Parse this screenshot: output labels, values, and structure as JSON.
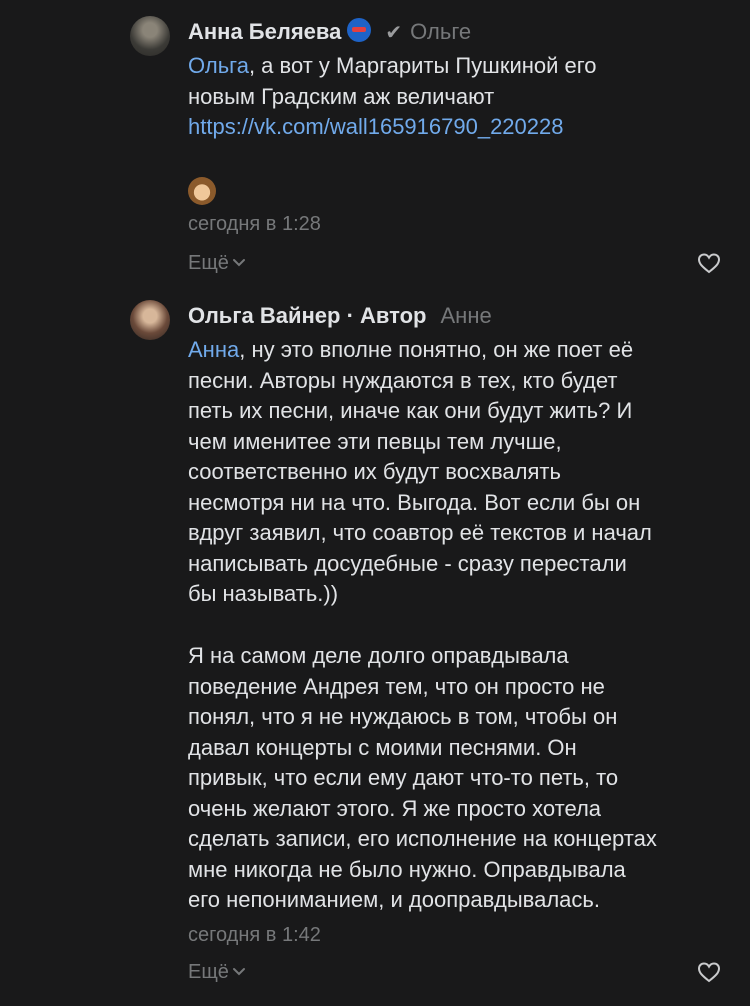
{
  "comments": [
    {
      "author": "Анна Беляева",
      "reply_to": "Ольге",
      "lines": {
        "l1_mention": "Ольга",
        "l1_rest": ", а вот у Маргариты Пушкиной его",
        "l2": "новым Градским аж величают",
        "l3_link": "https://vk.com/wall165916790_220228"
      },
      "emoji": "see-no-evil-monkey",
      "time": "сегодня в 1:28",
      "more_label": "Ещё",
      "avatar_icon": "avatar"
    },
    {
      "author": "Ольга Вайнер",
      "author_separator": " · ",
      "author_badge": "Автор",
      "reply_to": "Анне",
      "lines": [
        "Анна",
        ", ну это вполне понятно, он же поет её",
        "песни. Авторы нуждаются в тех, кто будет",
        "петь их песни, иначе как они будут жить? И",
        "чем именитее эти певцы тем лучше,",
        "соответственно их будут восхвалять",
        "несмотря ни на что. Выгода. Вот если бы он",
        "вдруг заявил, что соавтор её текстов и начал",
        "написывать досудебные - сразу перестали",
        "бы называть.))",
        "Я на самом деле долго оправдывала",
        "поведение Андрея тем, что он просто не",
        "понял, что я не нуждаюсь в том, чтобы он",
        "давал концерты с моими песнями. Он",
        "привык, что если ему дают что-то петь, то",
        "очень желают этого. Я же просто хотела",
        "сделать записи, его исполнение на концертах",
        "мне никогда не было нужно. Оправдывала",
        "его непониманием, и дооправдывалась."
      ],
      "time": "сегодня в 1:42",
      "more_label": "Ещё"
    }
  ],
  "colors": {
    "background": "#19191a",
    "text": "#e1e3e6",
    "muted": "#76787a",
    "link": "#71aaeb"
  }
}
